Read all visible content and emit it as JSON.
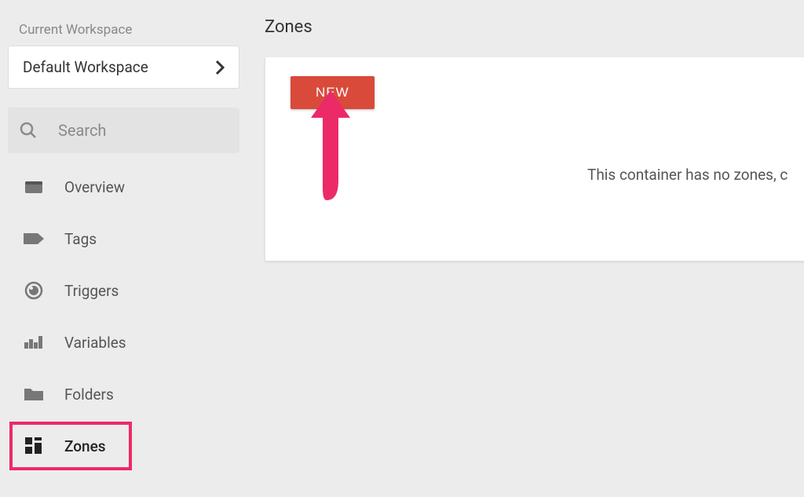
{
  "sidebar": {
    "workspace_label": "Current Workspace",
    "workspace_name": "Default Workspace",
    "search_placeholder": "Search",
    "nav": [
      {
        "label": "Overview",
        "icon": "overview"
      },
      {
        "label": "Tags",
        "icon": "tag"
      },
      {
        "label": "Triggers",
        "icon": "trigger"
      },
      {
        "label": "Variables",
        "icon": "variables"
      },
      {
        "label": "Folders",
        "icon": "folder"
      },
      {
        "label": "Zones",
        "icon": "zones",
        "active": true
      }
    ]
  },
  "main": {
    "title": "Zones",
    "new_button": "NEW",
    "empty_text": "This container has no zones, c"
  },
  "colors": {
    "accent_button": "#d94a3a",
    "highlight": "#ec2a68"
  }
}
